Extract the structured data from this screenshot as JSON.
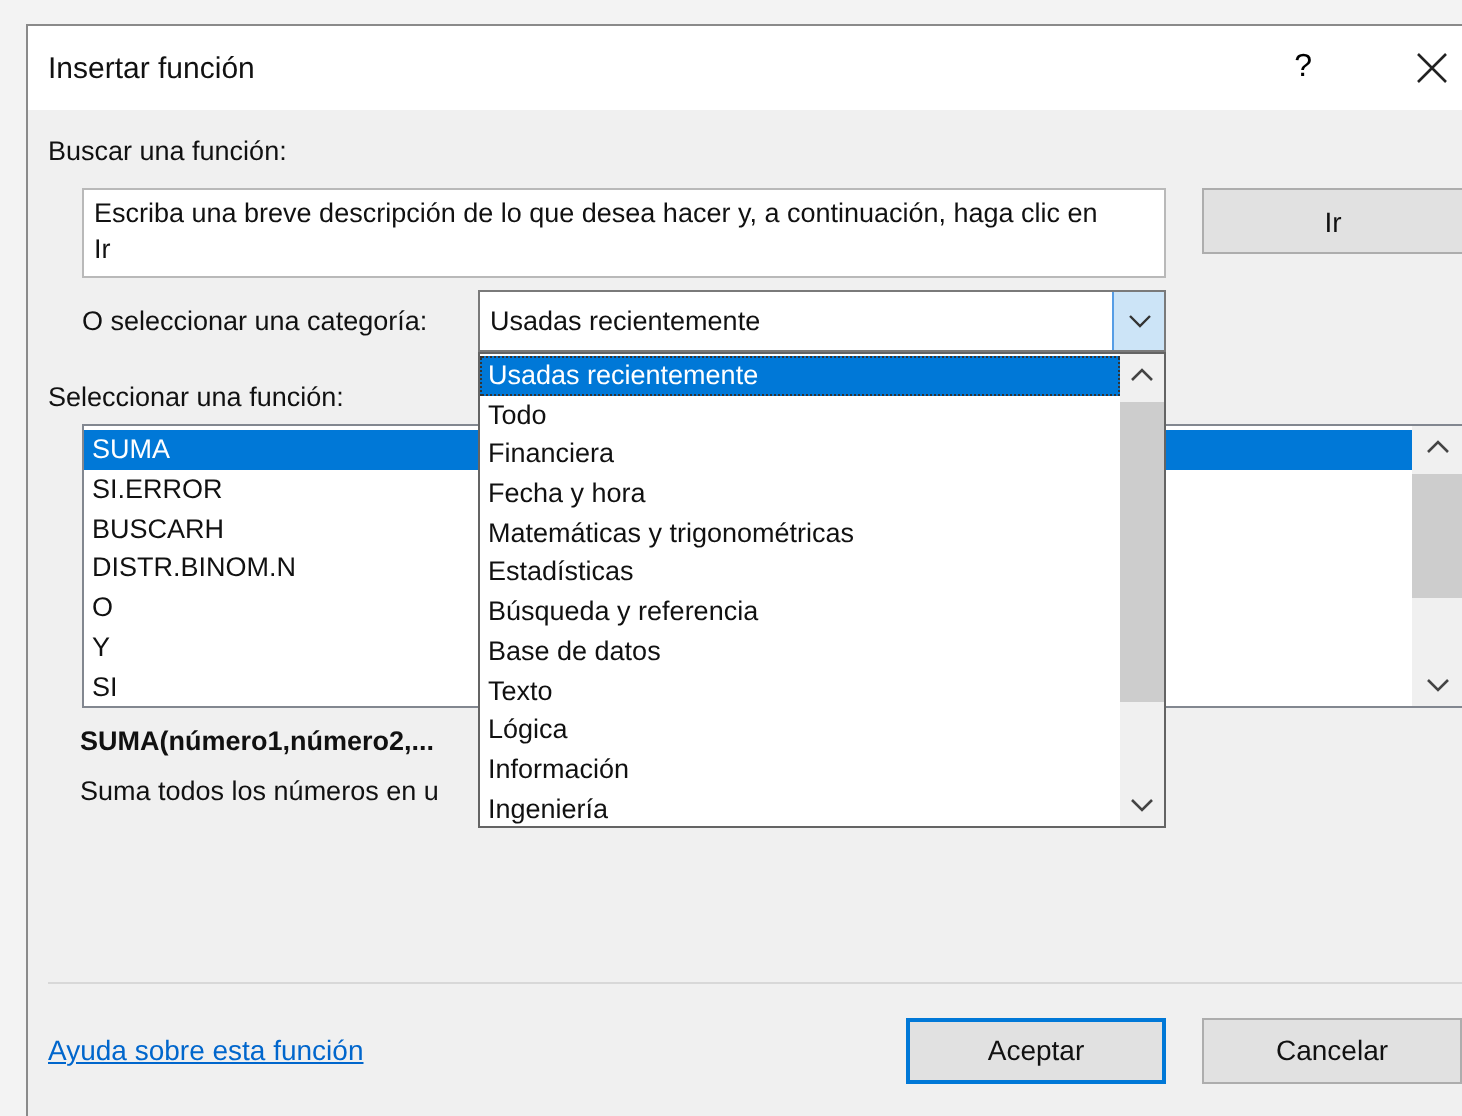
{
  "window": {
    "title": "Insertar función",
    "help": "?"
  },
  "search": {
    "label": "Buscar una función:",
    "value": "Escriba una breve descripción de lo que desea hacer y, a continuación, haga clic en Ir",
    "button": "Ir"
  },
  "category": {
    "label": "O seleccionar una categoría:",
    "value": "Usadas recientemente",
    "expanded": true,
    "options": [
      {
        "label": "Usadas recientemente",
        "selected": true
      },
      {
        "label": "Todo",
        "selected": false
      },
      {
        "label": "Financiera",
        "selected": false
      },
      {
        "label": "Fecha y hora",
        "selected": false
      },
      {
        "label": "Matemáticas y trigonométricas",
        "selected": false
      },
      {
        "label": "Estadísticas",
        "selected": false
      },
      {
        "label": "Búsqueda y referencia",
        "selected": false
      },
      {
        "label": "Base de datos",
        "selected": false
      },
      {
        "label": "Texto",
        "selected": false
      },
      {
        "label": "Lógica",
        "selected": false
      },
      {
        "label": "Información",
        "selected": false
      },
      {
        "label": "Ingeniería",
        "selected": false
      }
    ]
  },
  "functions": {
    "label": "Seleccionar una función:",
    "items": [
      {
        "label": "SUMA",
        "selected": true
      },
      {
        "label": "SI.ERROR",
        "selected": false
      },
      {
        "label": "BUSCARH",
        "selected": false
      },
      {
        "label": "DISTR.BINOM.N",
        "selected": false
      },
      {
        "label": "O",
        "selected": false
      },
      {
        "label": "Y",
        "selected": false
      },
      {
        "label": "SI",
        "selected": false
      }
    ]
  },
  "signature": "SUMA(número1,número2,...",
  "description": "Suma todos los números en u",
  "help_link": "Ayuda sobre esta función",
  "buttons": [
    {
      "label": "Aceptar",
      "default": true
    },
    {
      "label": "Cancelar",
      "default": false
    }
  ]
}
